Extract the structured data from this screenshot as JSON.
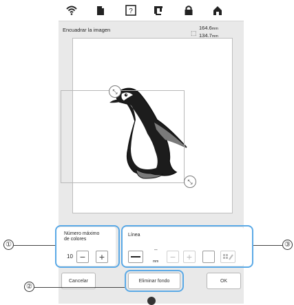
{
  "topbar": {
    "icons": [
      "wifi-icon",
      "document-icon",
      "help-icon",
      "embroidery-icon",
      "lock-icon",
      "home-icon"
    ]
  },
  "header": {
    "title": "Encuadrar la imagen",
    "width": "164.6",
    "height": "134.7",
    "unit": "mm"
  },
  "controls": {
    "colors": {
      "label_line1": "Número máximo",
      "label_line2": "de colores",
      "value": "10",
      "minus": "−",
      "plus": "+"
    },
    "line": {
      "label": "Línea",
      "value": "--",
      "unit": "mm",
      "minus": "−",
      "plus": "+"
    }
  },
  "buttons": {
    "cancel": "Cancelar",
    "remove_background": "Eliminar fondo",
    "ok": "OK"
  },
  "callouts": {
    "c1": "①",
    "c2": "②",
    "c3": "③"
  }
}
